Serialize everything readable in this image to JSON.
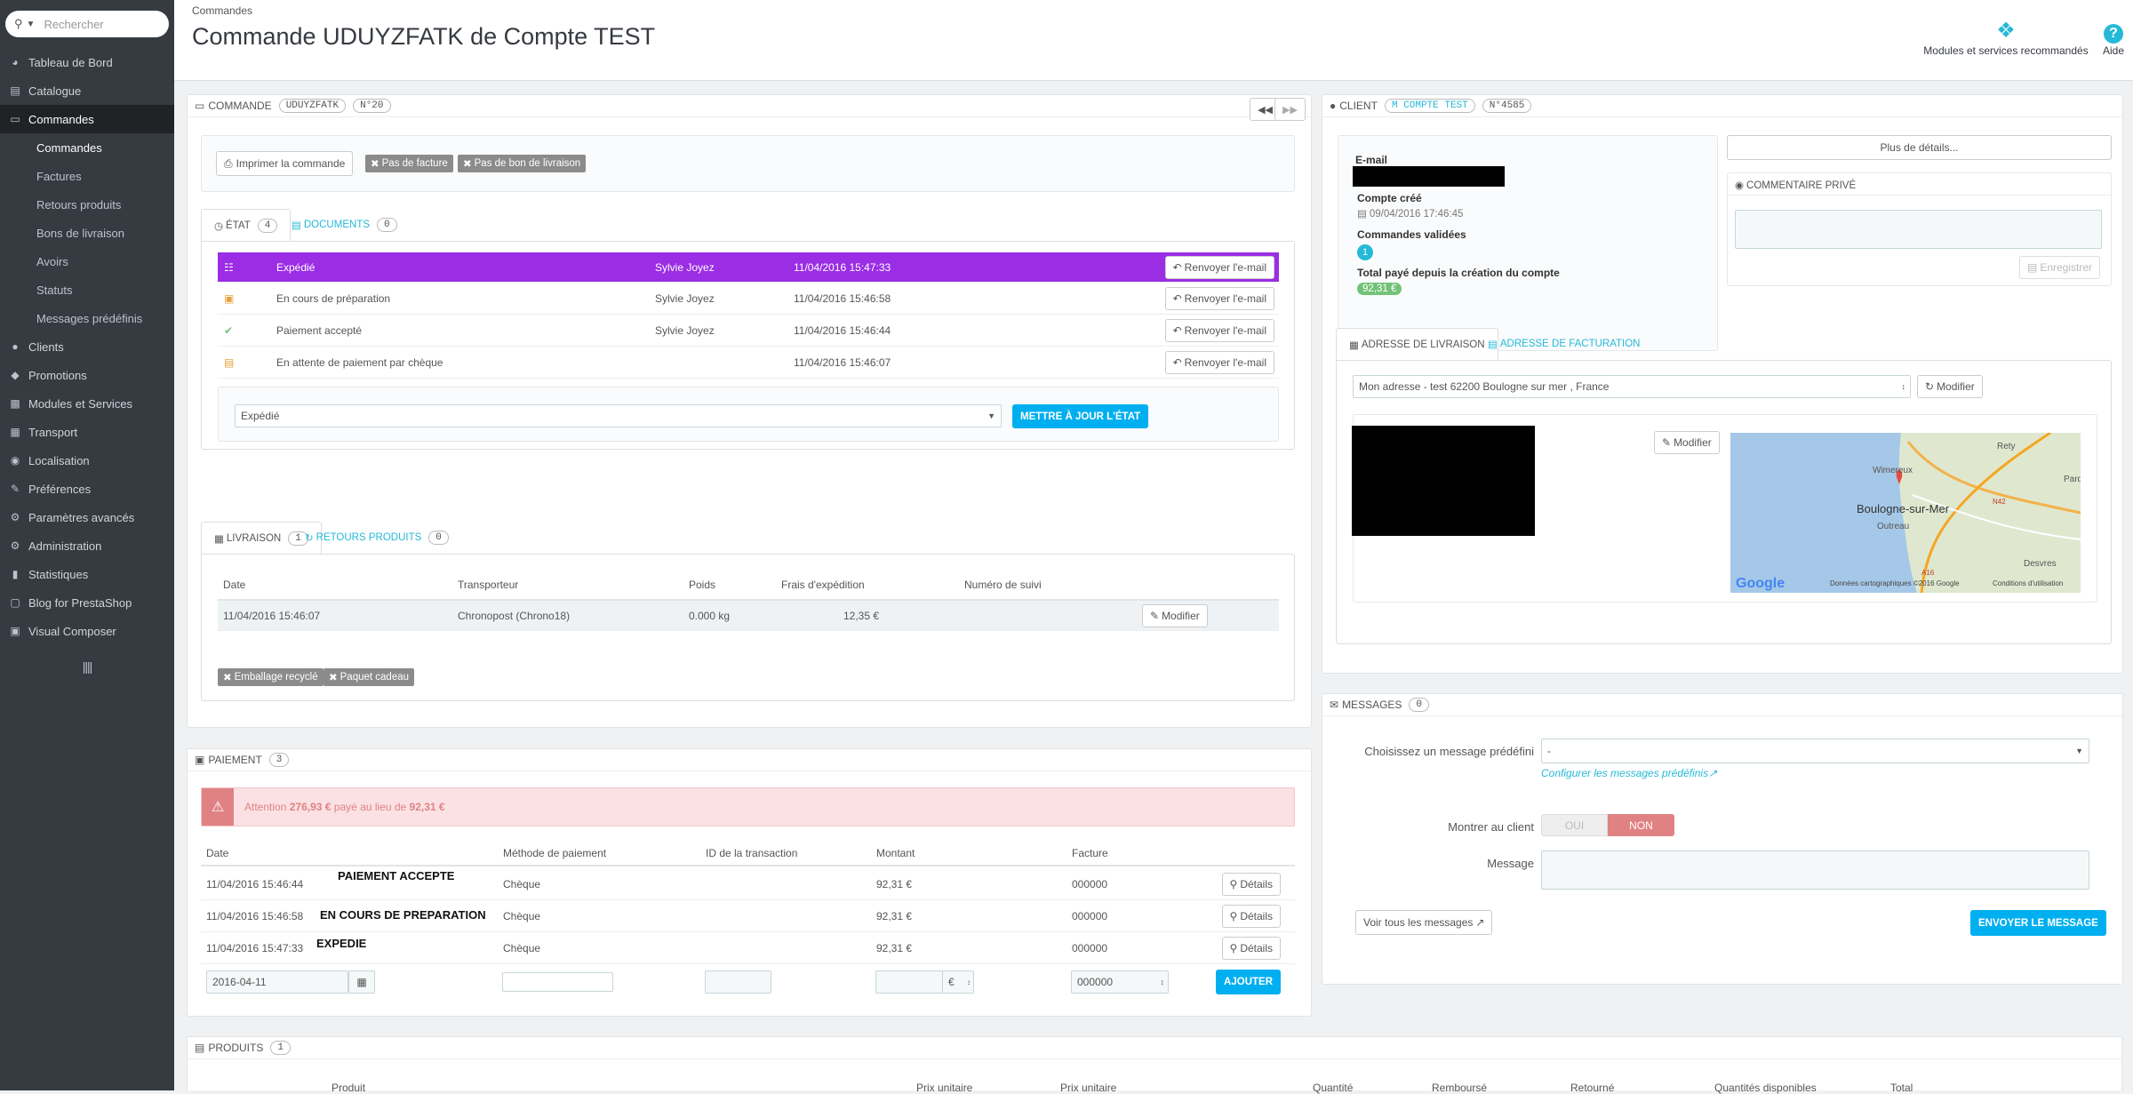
{
  "search": {
    "placeholder": "Rechercher"
  },
  "sidebar": {
    "items": [
      {
        "label": "Tableau de Bord",
        "icon": "dashboard-icon"
      },
      {
        "label": "Catalogue",
        "icon": "catalog-icon"
      },
      {
        "label": "Commandes",
        "icon": "credit-card-icon"
      },
      {
        "label": "Clients",
        "icon": "users-icon"
      },
      {
        "label": "Promotions",
        "icon": "tag-icon"
      },
      {
        "label": "Modules et Services",
        "icon": "puzzle-icon"
      },
      {
        "label": "Transport",
        "icon": "truck-icon"
      },
      {
        "label": "Localisation",
        "icon": "globe-icon"
      },
      {
        "label": "Préférences",
        "icon": "wrench-icon"
      },
      {
        "label": "Paramètres avancés",
        "icon": "cogs-icon"
      },
      {
        "label": "Administration",
        "icon": "gear-icon"
      },
      {
        "label": "Statistiques",
        "icon": "bar-chart-icon"
      },
      {
        "label": "Blog for PrestaShop",
        "icon": "blog-icon"
      },
      {
        "label": "Visual Composer",
        "icon": "composer-icon"
      }
    ],
    "subitems": [
      "Commandes",
      "Factures",
      "Retours produits",
      "Bons de livraison",
      "Avoirs",
      "Statuts",
      "Messages prédéfinis"
    ],
    "collapse": "||||"
  },
  "header": {
    "breadcrumb": "Commandes",
    "title": "Commande UDUYZFATK de Compte TEST",
    "modules_label": "Modules et services recommandés",
    "help_label": "Aide"
  },
  "order": {
    "heading": "Commande",
    "reference": "UDUYZFATK",
    "number": "N°20",
    "print_btn": "Imprimer la commande",
    "no_invoice": "Pas de facture",
    "no_delivery": "Pas de bon de livraison",
    "tab_state": "État",
    "tab_state_count": "4",
    "tab_docs": "Documents",
    "tab_docs_count": "0",
    "history": [
      {
        "status": "Expédié",
        "employee": "Sylvie Joyez",
        "date": "11/04/2016 15:47:33",
        "action": "Renvoyer l'e-mail"
      },
      {
        "status": "En cours de préparation",
        "employee": "Sylvie Joyez",
        "date": "11/04/2016 15:46:58",
        "action": "Renvoyer l'e-mail"
      },
      {
        "status": "Paiement accepté",
        "employee": "Sylvie Joyez",
        "date": "11/04/2016 15:46:44",
        "action": "Renvoyer l'e-mail"
      },
      {
        "status": "En attente de paiement par chèque",
        "employee": "",
        "date": "11/04/2016 15:46:07",
        "action": "Renvoyer l'e-mail"
      }
    ],
    "state_select": "Expédié",
    "update_btn": "Mettre à jour l'état",
    "tab_delivery": "Livraison",
    "tab_delivery_count": "1",
    "tab_returns": "Retours produits",
    "tab_returns_count": "0",
    "ship_headers": [
      "Date",
      "Transporteur",
      "Poids",
      "Frais d'expédition",
      "Numéro de suivi"
    ],
    "shipment": {
      "date": "11/04/2016 15:46:07",
      "carrier": "Chronopost (Chrono18)",
      "weight": "0.000 kg",
      "cost": "12,35 €",
      "edit": "Modifier"
    },
    "recycled": "Emballage recyclé",
    "gift": "Paquet cadeau"
  },
  "payment": {
    "heading": "Paiement",
    "count": "3",
    "alert_pre": "Attention",
    "alert_paid": "276,93 €",
    "alert_mid": "payé au lieu de",
    "alert_due": "92,31 €",
    "headers": [
      "Date",
      "Méthode de paiement",
      "ID de la transaction",
      "Montant",
      "Facture"
    ],
    "rows": [
      {
        "date": "11/04/2016 15:46:44",
        "note": "PAIEMENT ACCEPTE",
        "method": "Chèque",
        "amount": "92,31 €",
        "invoice": "000000",
        "details": "Détails"
      },
      {
        "date": "11/04/2016 15:46:58",
        "note": "EN COURS DE PREPARATION",
        "method": "Chèque",
        "amount": "92,31 €",
        "invoice": "000000",
        "details": "Détails"
      },
      {
        "date": "11/04/2016 15:47:33",
        "note": "EXPEDIE",
        "method": "Chèque",
        "amount": "92,31 €",
        "invoice": "000000",
        "details": "Détails"
      }
    ],
    "new_date": "2016-04-11",
    "currency": "€",
    "invoice_select": "000000",
    "add_btn": "Ajouter"
  },
  "products": {
    "heading": "Produits",
    "count": "1",
    "headers": [
      "Produit",
      "Prix unitaire",
      "Prix unitaire",
      "Quantité",
      "Remboursé",
      "Retourné",
      "Quantités disponibles",
      "Total"
    ]
  },
  "client": {
    "heading": "Client",
    "name": "M COMPTE TEST",
    "number": "N°4585",
    "email_label": "E-mail",
    "created_label": "Compte créé",
    "created_date": "09/04/2016 17:46:45",
    "valid_orders_label": "Commandes validées",
    "valid_orders": "1",
    "total_label": "Total payé depuis la création du compte",
    "total": "92,31 €",
    "details_btn": "Plus de détails...",
    "private_note": "Commentaire privé",
    "save_btn": "Enregistrer",
    "tab_shipping": "Adresse de livraison",
    "tab_invoice": "Adresse de facturation",
    "address_select": "Mon adresse - test 62200 Boulogne sur mer , France",
    "modify": "Modifier",
    "map": {
      "city": "Boulogne-sur-Mer",
      "places": [
        "Rety",
        "Wimereux",
        "Outreau",
        "Desvres",
        "Pard"
      ],
      "brand": "Google",
      "credits": "Données cartographiques ©2016 Google",
      "terms": "Conditions d'utilisation",
      "roads": [
        "N42",
        "A16"
      ]
    }
  },
  "messages": {
    "heading": "Messages",
    "count": "0",
    "predefined_label": "Choisissez un message prédéfini",
    "predefined_value": "-",
    "configure_link": "Configurer les messages prédéfinis",
    "show_label": "Montrer au client",
    "yes": "OUI",
    "no": "NON",
    "message_label": "Message",
    "view_all": "Voir tous les messages",
    "send_btn": "Envoyer le message"
  }
}
